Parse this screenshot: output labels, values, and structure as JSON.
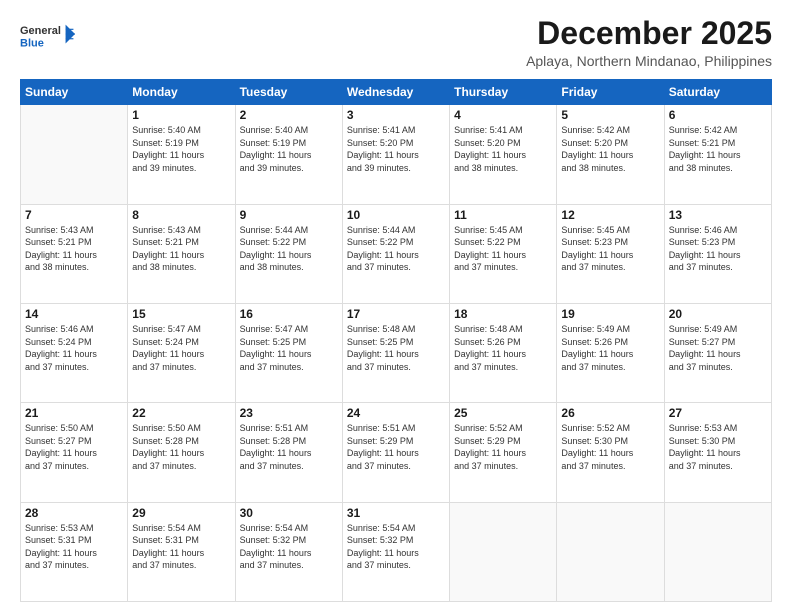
{
  "header": {
    "logo_general": "General",
    "logo_blue": "Blue",
    "main_title": "December 2025",
    "subtitle": "Aplaya, Northern Mindanao, Philippines"
  },
  "calendar": {
    "days_of_week": [
      "Sunday",
      "Monday",
      "Tuesday",
      "Wednesday",
      "Thursday",
      "Friday",
      "Saturday"
    ],
    "weeks": [
      [
        {
          "day": "",
          "info": ""
        },
        {
          "day": "1",
          "info": "Sunrise: 5:40 AM\nSunset: 5:19 PM\nDaylight: 11 hours\nand 39 minutes."
        },
        {
          "day": "2",
          "info": "Sunrise: 5:40 AM\nSunset: 5:19 PM\nDaylight: 11 hours\nand 39 minutes."
        },
        {
          "day": "3",
          "info": "Sunrise: 5:41 AM\nSunset: 5:20 PM\nDaylight: 11 hours\nand 39 minutes."
        },
        {
          "day": "4",
          "info": "Sunrise: 5:41 AM\nSunset: 5:20 PM\nDaylight: 11 hours\nand 38 minutes."
        },
        {
          "day": "5",
          "info": "Sunrise: 5:42 AM\nSunset: 5:20 PM\nDaylight: 11 hours\nand 38 minutes."
        },
        {
          "day": "6",
          "info": "Sunrise: 5:42 AM\nSunset: 5:21 PM\nDaylight: 11 hours\nand 38 minutes."
        }
      ],
      [
        {
          "day": "7",
          "info": "Sunrise: 5:43 AM\nSunset: 5:21 PM\nDaylight: 11 hours\nand 38 minutes."
        },
        {
          "day": "8",
          "info": "Sunrise: 5:43 AM\nSunset: 5:21 PM\nDaylight: 11 hours\nand 38 minutes."
        },
        {
          "day": "9",
          "info": "Sunrise: 5:44 AM\nSunset: 5:22 PM\nDaylight: 11 hours\nand 38 minutes."
        },
        {
          "day": "10",
          "info": "Sunrise: 5:44 AM\nSunset: 5:22 PM\nDaylight: 11 hours\nand 37 minutes."
        },
        {
          "day": "11",
          "info": "Sunrise: 5:45 AM\nSunset: 5:22 PM\nDaylight: 11 hours\nand 37 minutes."
        },
        {
          "day": "12",
          "info": "Sunrise: 5:45 AM\nSunset: 5:23 PM\nDaylight: 11 hours\nand 37 minutes."
        },
        {
          "day": "13",
          "info": "Sunrise: 5:46 AM\nSunset: 5:23 PM\nDaylight: 11 hours\nand 37 minutes."
        }
      ],
      [
        {
          "day": "14",
          "info": "Sunrise: 5:46 AM\nSunset: 5:24 PM\nDaylight: 11 hours\nand 37 minutes."
        },
        {
          "day": "15",
          "info": "Sunrise: 5:47 AM\nSunset: 5:24 PM\nDaylight: 11 hours\nand 37 minutes."
        },
        {
          "day": "16",
          "info": "Sunrise: 5:47 AM\nSunset: 5:25 PM\nDaylight: 11 hours\nand 37 minutes."
        },
        {
          "day": "17",
          "info": "Sunrise: 5:48 AM\nSunset: 5:25 PM\nDaylight: 11 hours\nand 37 minutes."
        },
        {
          "day": "18",
          "info": "Sunrise: 5:48 AM\nSunset: 5:26 PM\nDaylight: 11 hours\nand 37 minutes."
        },
        {
          "day": "19",
          "info": "Sunrise: 5:49 AM\nSunset: 5:26 PM\nDaylight: 11 hours\nand 37 minutes."
        },
        {
          "day": "20",
          "info": "Sunrise: 5:49 AM\nSunset: 5:27 PM\nDaylight: 11 hours\nand 37 minutes."
        }
      ],
      [
        {
          "day": "21",
          "info": "Sunrise: 5:50 AM\nSunset: 5:27 PM\nDaylight: 11 hours\nand 37 minutes."
        },
        {
          "day": "22",
          "info": "Sunrise: 5:50 AM\nSunset: 5:28 PM\nDaylight: 11 hours\nand 37 minutes."
        },
        {
          "day": "23",
          "info": "Sunrise: 5:51 AM\nSunset: 5:28 PM\nDaylight: 11 hours\nand 37 minutes."
        },
        {
          "day": "24",
          "info": "Sunrise: 5:51 AM\nSunset: 5:29 PM\nDaylight: 11 hours\nand 37 minutes."
        },
        {
          "day": "25",
          "info": "Sunrise: 5:52 AM\nSunset: 5:29 PM\nDaylight: 11 hours\nand 37 minutes."
        },
        {
          "day": "26",
          "info": "Sunrise: 5:52 AM\nSunset: 5:30 PM\nDaylight: 11 hours\nand 37 minutes."
        },
        {
          "day": "27",
          "info": "Sunrise: 5:53 AM\nSunset: 5:30 PM\nDaylight: 11 hours\nand 37 minutes."
        }
      ],
      [
        {
          "day": "28",
          "info": "Sunrise: 5:53 AM\nSunset: 5:31 PM\nDaylight: 11 hours\nand 37 minutes."
        },
        {
          "day": "29",
          "info": "Sunrise: 5:54 AM\nSunset: 5:31 PM\nDaylight: 11 hours\nand 37 minutes."
        },
        {
          "day": "30",
          "info": "Sunrise: 5:54 AM\nSunset: 5:32 PM\nDaylight: 11 hours\nand 37 minutes."
        },
        {
          "day": "31",
          "info": "Sunrise: 5:54 AM\nSunset: 5:32 PM\nDaylight: 11 hours\nand 37 minutes."
        },
        {
          "day": "",
          "info": ""
        },
        {
          "day": "",
          "info": ""
        },
        {
          "day": "",
          "info": ""
        }
      ]
    ]
  }
}
